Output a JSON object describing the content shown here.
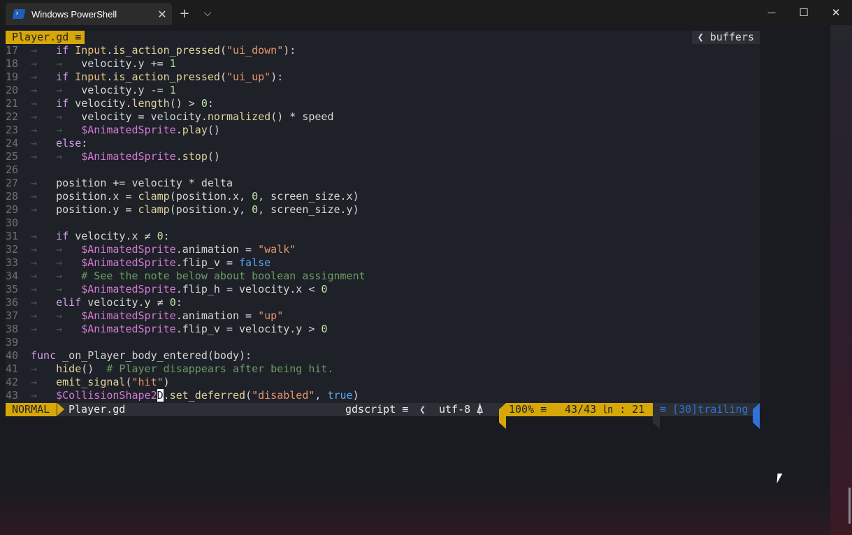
{
  "window": {
    "title": "Windows PowerShell",
    "tab_close": "✕",
    "new_tab": "+",
    "dropdown": "⌵",
    "minimize": "—",
    "maximize": "☐",
    "close": "✕"
  },
  "colors": {
    "accent": "#d7a707",
    "background": "#1e2127",
    "statusbar": "#2c2f36",
    "trailing": "#2f72d9"
  },
  "editor": {
    "buffer_name": "Player.gd ≡",
    "buffers_label": "❮ buffers",
    "lines": [
      {
        "n": "17",
        "t": [
          [
            "ind",
            "→   "
          ],
          [
            "kw",
            "if "
          ],
          [
            "cls",
            "Input"
          ],
          [
            "",
            "."
          ],
          [
            "fn",
            "is_action_pressed"
          ],
          [
            "",
            "("
          ],
          [
            "str",
            "\"ui_down\""
          ],
          [
            "",
            "):"
          ]
        ]
      },
      {
        "n": "18",
        "t": [
          [
            "ind",
            "→   →   "
          ],
          [
            "",
            "velocity.y += "
          ],
          [
            "num",
            "1"
          ]
        ]
      },
      {
        "n": "19",
        "t": [
          [
            "ind",
            "→   "
          ],
          [
            "kw",
            "if "
          ],
          [
            "cls",
            "Input"
          ],
          [
            "",
            "."
          ],
          [
            "fn",
            "is_action_pressed"
          ],
          [
            "",
            "("
          ],
          [
            "str",
            "\"ui_up\""
          ],
          [
            "",
            "):"
          ]
        ]
      },
      {
        "n": "20",
        "t": [
          [
            "ind",
            "→   →   "
          ],
          [
            "",
            "velocity.y -= "
          ],
          [
            "num",
            "1"
          ]
        ]
      },
      {
        "n": "21",
        "t": [
          [
            "ind",
            "→   "
          ],
          [
            "kw",
            "if "
          ],
          [
            "",
            "velocity."
          ],
          [
            "fn",
            "length"
          ],
          [
            "",
            "() > "
          ],
          [
            "num",
            "0"
          ],
          [
            "",
            ":"
          ]
        ]
      },
      {
        "n": "22",
        "t": [
          [
            "ind",
            "→   →   "
          ],
          [
            "",
            "velocity = velocity."
          ],
          [
            "fn",
            "normalized"
          ],
          [
            "",
            "() * speed"
          ]
        ]
      },
      {
        "n": "23",
        "t": [
          [
            "ind",
            "→   →   "
          ],
          [
            "node",
            "$AnimatedSprite"
          ],
          [
            "",
            "."
          ],
          [
            "fn",
            "play"
          ],
          [
            "",
            "()"
          ]
        ]
      },
      {
        "n": "24",
        "t": [
          [
            "ind",
            "→   "
          ],
          [
            "kw",
            "else"
          ],
          [
            "",
            ":"
          ]
        ]
      },
      {
        "n": "25",
        "t": [
          [
            "ind",
            "→   →   "
          ],
          [
            "node",
            "$AnimatedSprite"
          ],
          [
            "",
            "."
          ],
          [
            "fn",
            "stop"
          ],
          [
            "",
            "()"
          ]
        ]
      },
      {
        "n": "26",
        "t": []
      },
      {
        "n": "27",
        "t": [
          [
            "ind",
            "→   "
          ],
          [
            "",
            "position += velocity * delta"
          ]
        ]
      },
      {
        "n": "28",
        "t": [
          [
            "ind",
            "→   "
          ],
          [
            "",
            "position.x = "
          ],
          [
            "fn",
            "clamp"
          ],
          [
            "",
            "(position.x, "
          ],
          [
            "num",
            "0"
          ],
          [
            "",
            ", screen_size.x)"
          ]
        ]
      },
      {
        "n": "29",
        "t": [
          [
            "ind",
            "→   "
          ],
          [
            "",
            "position.y = "
          ],
          [
            "fn",
            "clamp"
          ],
          [
            "",
            "(position.y, "
          ],
          [
            "num",
            "0"
          ],
          [
            "",
            ", screen_size.y)"
          ]
        ]
      },
      {
        "n": "30",
        "t": []
      },
      {
        "n": "31",
        "t": [
          [
            "ind",
            "→   "
          ],
          [
            "kw",
            "if "
          ],
          [
            "",
            "velocity.x ≠ "
          ],
          [
            "num",
            "0"
          ],
          [
            "",
            ":"
          ]
        ]
      },
      {
        "n": "32",
        "t": [
          [
            "ind",
            "→   →   "
          ],
          [
            "node",
            "$AnimatedSprite"
          ],
          [
            "",
            ".animation = "
          ],
          [
            "str",
            "\"walk\""
          ]
        ]
      },
      {
        "n": "33",
        "t": [
          [
            "ind",
            "→   →   "
          ],
          [
            "node",
            "$AnimatedSprite"
          ],
          [
            "",
            ".flip_v = "
          ],
          [
            "bool",
            "false"
          ]
        ]
      },
      {
        "n": "34",
        "t": [
          [
            "ind",
            "→   →   "
          ],
          [
            "cmt",
            "# See the note below about boolean assignment"
          ]
        ]
      },
      {
        "n": "35",
        "t": [
          [
            "ind",
            "→   →   "
          ],
          [
            "node",
            "$AnimatedSprite"
          ],
          [
            "",
            ".flip_h = velocity.x < "
          ],
          [
            "num",
            "0"
          ]
        ]
      },
      {
        "n": "36",
        "t": [
          [
            "ind",
            "→   "
          ],
          [
            "kw",
            "elif "
          ],
          [
            "",
            "velocity.y ≠ "
          ],
          [
            "num",
            "0"
          ],
          [
            "",
            ":"
          ]
        ]
      },
      {
        "n": "37",
        "t": [
          [
            "ind",
            "→   →   "
          ],
          [
            "node",
            "$AnimatedSprite"
          ],
          [
            "",
            ".animation = "
          ],
          [
            "str",
            "\"up\""
          ]
        ]
      },
      {
        "n": "38",
        "t": [
          [
            "ind",
            "→   →   "
          ],
          [
            "node",
            "$AnimatedSprite"
          ],
          [
            "",
            ".flip_v = velocity.y > "
          ],
          [
            "num",
            "0"
          ]
        ]
      },
      {
        "n": "39",
        "t": []
      },
      {
        "n": "40",
        "t": [
          [
            "kw",
            "func "
          ],
          [
            "",
            "_on_Player_body_entered(body):"
          ]
        ]
      },
      {
        "n": "41",
        "t": [
          [
            "ind",
            "→   "
          ],
          [
            "fn",
            "hide"
          ],
          [
            "",
            "()  "
          ],
          [
            "cmt",
            "# Player disappears after being hit."
          ]
        ]
      },
      {
        "n": "42",
        "t": [
          [
            "ind",
            "→   "
          ],
          [
            "fn",
            "emit_signal"
          ],
          [
            "",
            "("
          ],
          [
            "str",
            "\"hit\""
          ],
          [
            "",
            ")"
          ]
        ]
      },
      {
        "n": "43",
        "t": [
          [
            "ind",
            "→   "
          ],
          [
            "node",
            "$CollisionShape2"
          ],
          [
            "cursor",
            "D"
          ],
          [
            "",
            "."
          ],
          [
            "fn",
            "set_deferred"
          ],
          [
            "",
            "("
          ],
          [
            "str",
            "\"disabled\""
          ],
          [
            "",
            ", "
          ],
          [
            "bool",
            "true"
          ],
          [
            "",
            ")"
          ]
        ]
      }
    ]
  },
  "statusline": {
    "mode": "NORMAL",
    "file": "Player.gd",
    "filetype": "gdscript ≡",
    "encoding": "utf-8 ⍋",
    "percent": "100% ≡",
    "position": "43/43 ㏑ : 21",
    "trailing": "≡ [30]trailing"
  }
}
